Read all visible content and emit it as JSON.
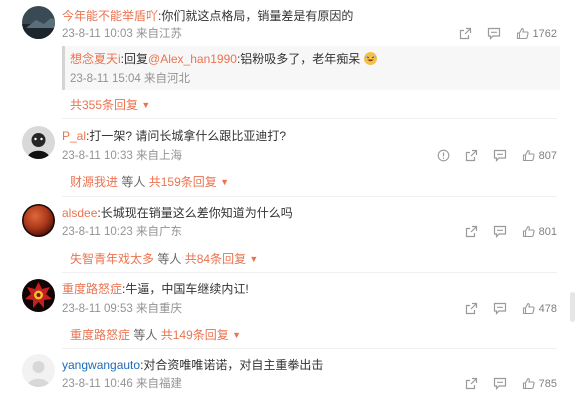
{
  "comments": [
    {
      "username": "今年能不能举盾吖",
      "text": ":你们就这点格局，销量差是有原因的",
      "date": "23-8-11 10:03",
      "location": "来自江苏",
      "likes": "1762",
      "reply": {
        "username": "想念夏天i",
        "text_prefix": ":回复",
        "mention": "@Alex_han1990",
        "text": ":铝粉吸多了，老年痴呆",
        "date": "23-8-11 15:04",
        "location": "来自河北"
      },
      "more_total": "共355条回复"
    },
    {
      "username": "P_al",
      "text": ":打一架? 请问长城拿什么跟比亚迪打?",
      "date": "23-8-11 10:33",
      "location": "来自上海",
      "likes": "807",
      "more_user": "财源我进",
      "more_etc": "等人",
      "more_total": "共159条回复"
    },
    {
      "username": "alsdee",
      "text": ":长城现在销量这么差你知道为什么吗",
      "date": "23-8-11 10:23",
      "location": "来自广东",
      "likes": "801",
      "more_user": "失智青年戏太多",
      "more_etc": "等人",
      "more_total": "共84条回复"
    },
    {
      "username": "重度路怒症",
      "text": ":牛逼，中国车继续内讧!",
      "date": "23-8-11 09:53",
      "location": "来自重庆",
      "likes": "478",
      "more_user": "重度路怒症",
      "more_etc": "等人",
      "more_total": "共149条回复"
    },
    {
      "username": "yangwangauto",
      "text": ":对合资唯唯诺诺，对自主重拳出击",
      "date": "23-8-11 10:46",
      "location": "来自福建",
      "likes": "785"
    }
  ],
  "icons": {
    "share": "share-icon",
    "comment": "comment-icon",
    "like": "like-icon",
    "report": "report-icon"
  },
  "colors": {
    "username": "#eb7350",
    "username_blue": "#1e6ab8",
    "meta": "#939393"
  }
}
